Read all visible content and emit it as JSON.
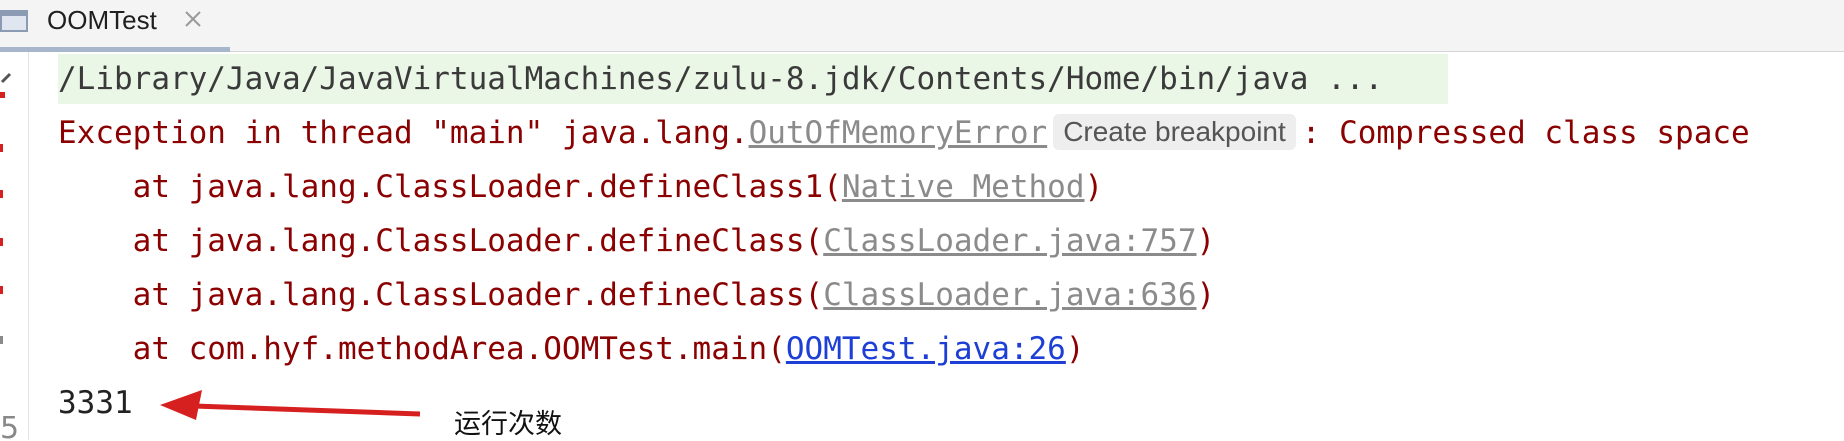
{
  "tab": {
    "title": "OOMTest"
  },
  "console": {
    "command": "/Library/Java/JavaVirtualMachines/zulu-8.jdk/Contents/Home/bin/java ...",
    "exception": {
      "prefix": "Exception in thread \"main\" java.lang.",
      "error_link": "OutOfMemoryError",
      "breakpoint_chip": "Create breakpoint",
      "suffix": ": Compressed class space"
    },
    "stack": [
      {
        "prefix": "    at java.lang.ClassLoader.defineClass1(",
        "link": "Native Method",
        "suffix": ")"
      },
      {
        "prefix": "    at java.lang.ClassLoader.defineClass(",
        "link": "ClassLoader.java:757",
        "suffix": ")"
      },
      {
        "prefix": "    at java.lang.ClassLoader.defineClass(",
        "link": "ClassLoader.java:636",
        "suffix": ")"
      },
      {
        "prefix": "    at com.hyf.methodArea.OOMTest.main(",
        "link": "OOMTest.java:26",
        "suffix": ")"
      }
    ],
    "output": "3331"
  },
  "annotation": {
    "text": "运行次数"
  },
  "colors": {
    "error_text": "#8b0000",
    "link_gray": "#8b8b8b",
    "link_blue": "#1d3fd6",
    "command_bg": "#eaf6e6",
    "arrow": "#d62020"
  }
}
